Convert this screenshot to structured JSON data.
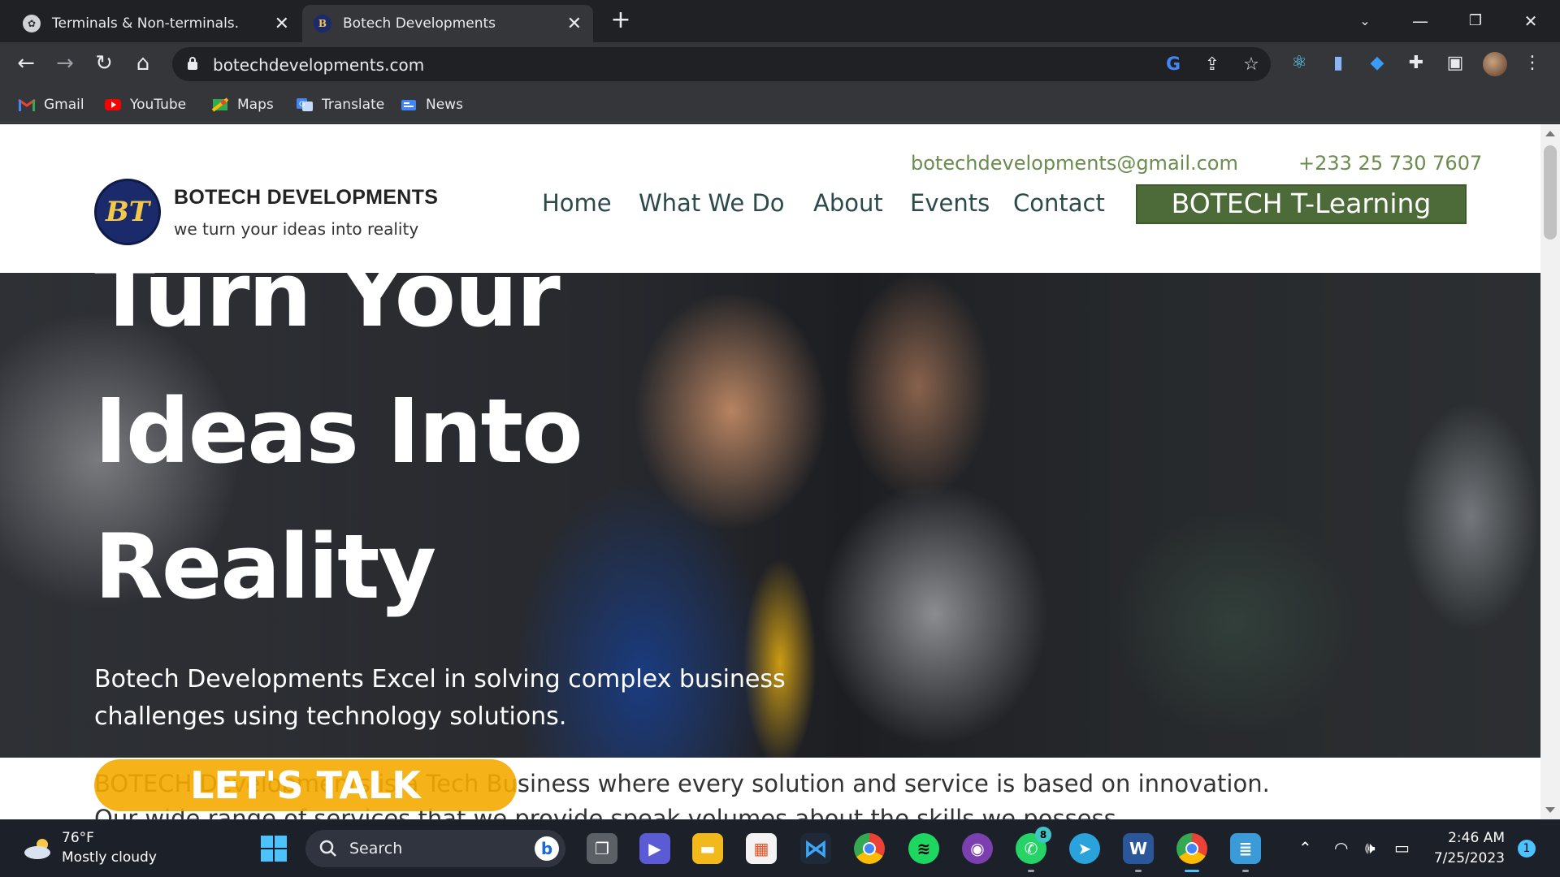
{
  "browser": {
    "tabs": [
      {
        "title": "Terminals & Non-terminals.",
        "active": false
      },
      {
        "title": "Botech Developments",
        "active": true
      }
    ],
    "url": "botechdevelopments.com",
    "bookmarks": [
      {
        "label": "Gmail",
        "icon": "gmail-icon"
      },
      {
        "label": "YouTube",
        "icon": "youtube-icon"
      },
      {
        "label": "Maps",
        "icon": "maps-icon"
      },
      {
        "label": "Translate",
        "icon": "translate-icon"
      },
      {
        "label": "News",
        "icon": "news-icon"
      }
    ]
  },
  "site": {
    "logo_text": "BT",
    "brand_name": "BOTECH DEVELOPMENTS",
    "tagline": "we turn your ideas into reality",
    "email": "botechdevelopments@gmail.com",
    "phone": "+233 25 730 7607",
    "nav": [
      "Home",
      "What We Do",
      "About",
      "Events",
      "Contact"
    ],
    "cta": "BOTECH T-Learning",
    "hero": {
      "line1": "Turn Your",
      "line2": "Ideas Into",
      "line3": "Reality",
      "subtitle": "Botech Developments Excel in solving complex business challenges using technology solutions."
    },
    "lets_talk": "LET'S TALK",
    "intro": "BOTECH Developments is a Tech Business where every solution and service is based on innovation.",
    "intro_2": "Our wide range of services that we provide speak volumes about the skills we possess."
  },
  "taskbar": {
    "weather_temp": "76°F",
    "weather_desc": "Mostly cloudy",
    "search_label": "Search",
    "whatsapp_badge": "8",
    "time": "2:46 AM",
    "date": "7/25/2023",
    "notifications": "1"
  },
  "colors": {
    "accent_green": "#4d6b38",
    "contact_green": "#6a8c4d",
    "nav_text": "#2d4a4a",
    "cta_orange": "#f5aa00",
    "logo_navy": "#1b2a6b"
  }
}
